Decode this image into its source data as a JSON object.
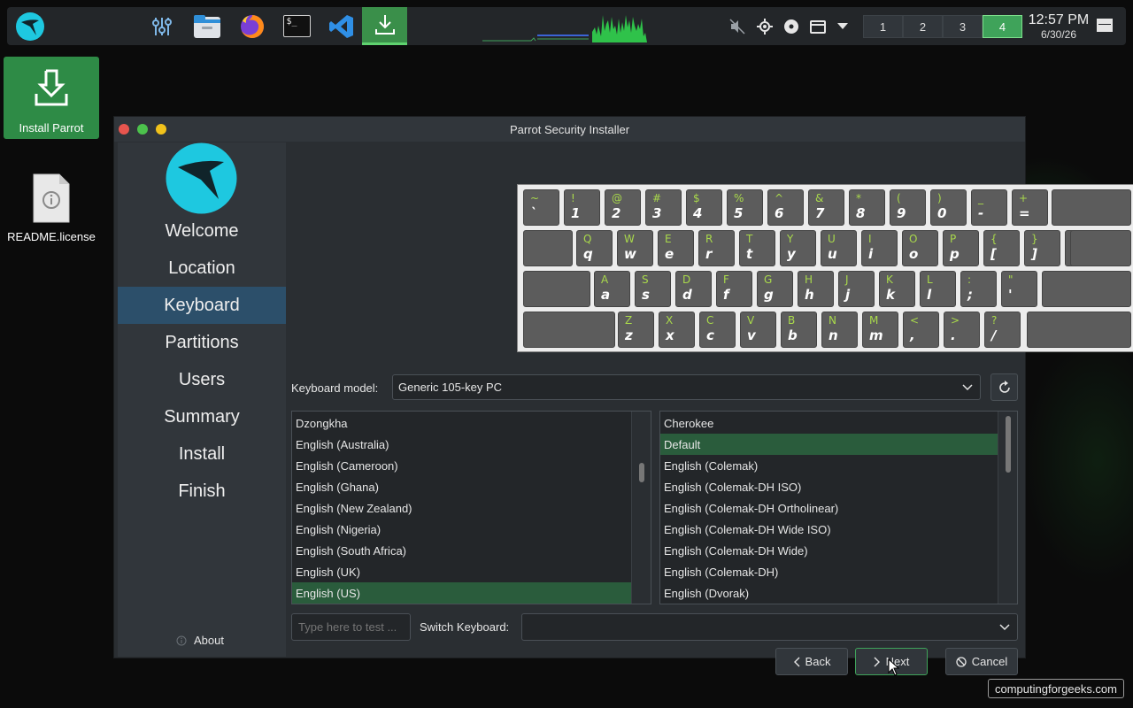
{
  "panel": {
    "launchers": [
      {
        "name": "parrot-menu-icon"
      },
      {
        "name": "settings-mixer-icon"
      },
      {
        "name": "file-manager-icon"
      },
      {
        "name": "firefox-icon"
      },
      {
        "name": "terminal-icon"
      },
      {
        "name": "vscode-icon"
      },
      {
        "name": "installer-icon"
      }
    ],
    "terminal_glyph": "$_",
    "pager": [
      "1",
      "2",
      "3",
      "4"
    ],
    "active_desktop": "4",
    "clock_time": "12:57 PM",
    "clock_date": "6/30/26"
  },
  "desktop": {
    "install_label": "Install Parrot",
    "readme_label": "README.license"
  },
  "window": {
    "title": "Parrot Security Installer",
    "buttons_colors": [
      "#e8554e",
      "#4cc24c",
      "#f1c21b"
    ]
  },
  "sidebar": {
    "items": [
      {
        "label": "Welcome"
      },
      {
        "label": "Location"
      },
      {
        "label": "Keyboard",
        "active": true
      },
      {
        "label": "Partitions"
      },
      {
        "label": "Users"
      },
      {
        "label": "Summary"
      },
      {
        "label": "Install"
      },
      {
        "label": "Finish"
      }
    ],
    "about": "About"
  },
  "keyboard_preview": {
    "rows": [
      [
        [
          "~",
          "`"
        ],
        [
          "!",
          "1"
        ],
        [
          "@",
          "2"
        ],
        [
          "#",
          "3"
        ],
        [
          "$",
          "4"
        ],
        [
          "%",
          "5"
        ],
        [
          "^",
          "6"
        ],
        [
          "&",
          "7"
        ],
        [
          "*",
          "8"
        ],
        [
          "(",
          "9"
        ],
        [
          ")",
          "0"
        ],
        [
          "_",
          "-"
        ],
        [
          "+",
          "="
        ]
      ],
      [
        [
          "Q",
          "q"
        ],
        [
          "W",
          "w"
        ],
        [
          "E",
          "e"
        ],
        [
          "R",
          "r"
        ],
        [
          "T",
          "t"
        ],
        [
          "Y",
          "y"
        ],
        [
          "U",
          "u"
        ],
        [
          "I",
          "i"
        ],
        [
          "O",
          "o"
        ],
        [
          "P",
          "p"
        ],
        [
          "{",
          "["
        ],
        [
          "}",
          "]"
        ],
        [
          "|",
          "\\"
        ]
      ],
      [
        [
          "A",
          "a"
        ],
        [
          "S",
          "s"
        ],
        [
          "D",
          "d"
        ],
        [
          "F",
          "f"
        ],
        [
          "G",
          "g"
        ],
        [
          "H",
          "h"
        ],
        [
          "J",
          "j"
        ],
        [
          "K",
          "k"
        ],
        [
          "L",
          "l"
        ],
        [
          ":",
          ";"
        ],
        [
          "\"",
          "'"
        ]
      ],
      [
        [
          "Z",
          "z"
        ],
        [
          "X",
          "x"
        ],
        [
          "C",
          "c"
        ],
        [
          "V",
          "v"
        ],
        [
          "B",
          "b"
        ],
        [
          "N",
          "n"
        ],
        [
          "M",
          "m"
        ],
        [
          "<",
          ","
        ],
        [
          ">",
          "."
        ],
        [
          "?",
          "/"
        ]
      ]
    ]
  },
  "model": {
    "label": "Keyboard model:",
    "value": "Generic 105-key PC"
  },
  "layouts": [
    "Dzongkha",
    "English (Australia)",
    "English (Cameroon)",
    "English (Ghana)",
    "English (New Zealand)",
    "English (Nigeria)",
    "English (South Africa)",
    "English (UK)",
    "English (US)"
  ],
  "selected_layout": "English (US)",
  "variants": [
    "Cherokee",
    "Default",
    "English (Colemak)",
    "English (Colemak-DH ISO)",
    "English (Colemak-DH Ortholinear)",
    "English (Colemak-DH Wide ISO)",
    "English (Colemak-DH Wide)",
    "English (Colemak-DH)",
    "English (Dvorak)"
  ],
  "selected_variant": "Default",
  "test_input": {
    "placeholder": "Type here to test ..."
  },
  "switch": {
    "label": "Switch Keyboard:",
    "value": ""
  },
  "actions": {
    "back": "Back",
    "next": "Next",
    "cancel": "Cancel"
  },
  "watermark": "computingforgeeks.com",
  "colors": {
    "accent_green": "#3fa35a",
    "selection_green": "#2a5c3c",
    "sidebar_active": "#2c4f6a",
    "key_shift_text": "#a9d94b"
  }
}
